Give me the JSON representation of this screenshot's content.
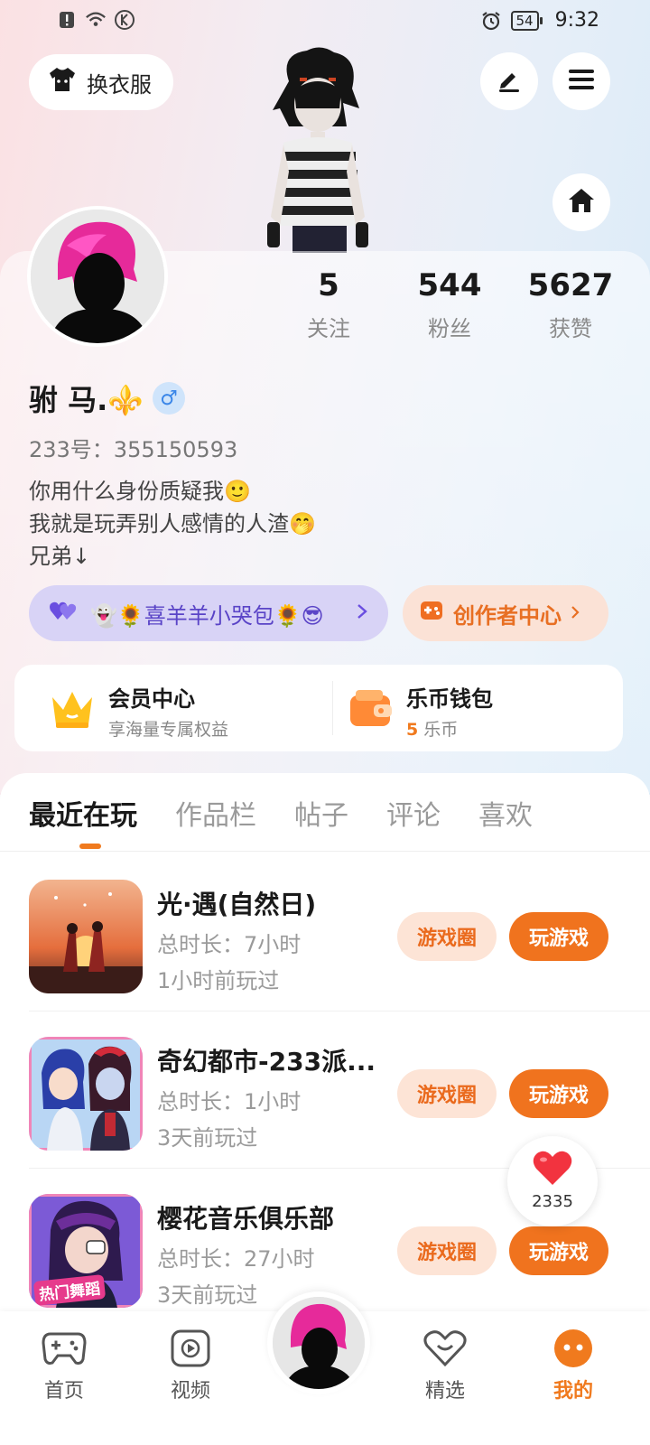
{
  "status_bar": {
    "time": "9:32",
    "battery": "54"
  },
  "top_actions": {
    "wardrobe_label": "换衣服"
  },
  "profile": {
    "name": "驸 马.⚜️",
    "gender_symbol": "♂",
    "uid": "233号：355150593",
    "bio_lines": [
      "你用什么身份质疑我🙂",
      "我就是玩弄别人感情的人渣🤭",
      "兄弟↓"
    ],
    "stats": [
      {
        "value": "5",
        "label": "关注"
      },
      {
        "value": "544",
        "label": "粉丝"
      },
      {
        "value": "5627",
        "label": "获赞"
      }
    ],
    "tag_pill": "👻🌻喜羊羊小哭包🌻😎",
    "creator_center": "创作者中心"
  },
  "vip": {
    "member_title": "会员中心",
    "member_sub": "享海量专属权益",
    "wallet_title": "乐币钱包",
    "wallet_amount": "5",
    "wallet_unit": " 乐币"
  },
  "tabs": [
    "最近在玩",
    "作品栏",
    "帖子",
    "评论",
    "喜欢"
  ],
  "games": [
    {
      "title": "光·遇(自然日)",
      "duration": "总时长：7小时",
      "last_played": "1小时前玩过",
      "circle_btn": "游戏圈",
      "play_btn": "玩游戏"
    },
    {
      "title": "奇幻都市-233派...",
      "duration": "总时长：1小时",
      "last_played": "3天前玩过",
      "circle_btn": "游戏圈",
      "play_btn": "玩游戏"
    },
    {
      "title": "樱花音乐俱乐部",
      "duration": "总时长：27小时",
      "last_played": "3天前玩过",
      "circle_btn": "游戏圈",
      "play_btn": "玩游戏",
      "thumb_badge": "热门舞蹈"
    }
  ],
  "like_bubble": {
    "count": "2335"
  },
  "bottom_nav": [
    "首页",
    "视频",
    "精选",
    "我的"
  ],
  "colors": {
    "accent": "#f07a1e",
    "tag_purple": "#5a44c7"
  }
}
